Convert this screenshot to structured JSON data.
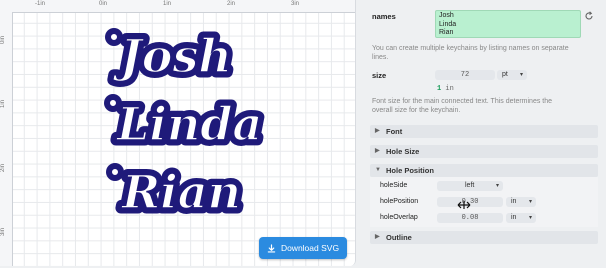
{
  "canvas": {
    "ruler_top_labels": [
      "-1in",
      "0in",
      "1in",
      "2in",
      "3in"
    ],
    "ruler_left_labels": [
      "0in",
      "1in",
      "2in",
      "3in"
    ],
    "keychain_names": [
      "Josh",
      "Linda",
      "Rian"
    ],
    "download_label": "Download SVG",
    "colors": {
      "outline": "#1f1a7a",
      "fill": "#ffffff",
      "button": "#2b8be0"
    }
  },
  "settings": {
    "names": {
      "label": "names",
      "lines": [
        "Josh",
        "Linda",
        "Rian"
      ],
      "help": [
        "You can create multiple keychains by listing names on separate",
        "lines."
      ]
    },
    "size": {
      "label": "size",
      "value": "72",
      "unit": "pt",
      "converted_value": "1",
      "converted_unit": "in",
      "help": [
        "Font size for the main connected text. This determines the",
        "overall size for the keychain."
      ]
    },
    "sections": {
      "font": "Font",
      "hole_size": "Hole Size",
      "hole_position": "Hole Position",
      "outline": "Outline"
    },
    "hole_position": {
      "hole_side": {
        "label": "holeSide",
        "value": "left"
      },
      "hole_pos": {
        "label": "holePosition",
        "value": "0.30",
        "unit": "in"
      },
      "hole_overlap": {
        "label": "holeOverlap",
        "value": "0.08",
        "unit": "in"
      }
    },
    "icons": {
      "reset": "reset-icon",
      "collapsed": "triangle-right-icon",
      "expanded": "triangle-down-icon",
      "select": "chevron-down-icon",
      "download": "download-icon",
      "cursor": "resize-cursor-icon"
    }
  }
}
